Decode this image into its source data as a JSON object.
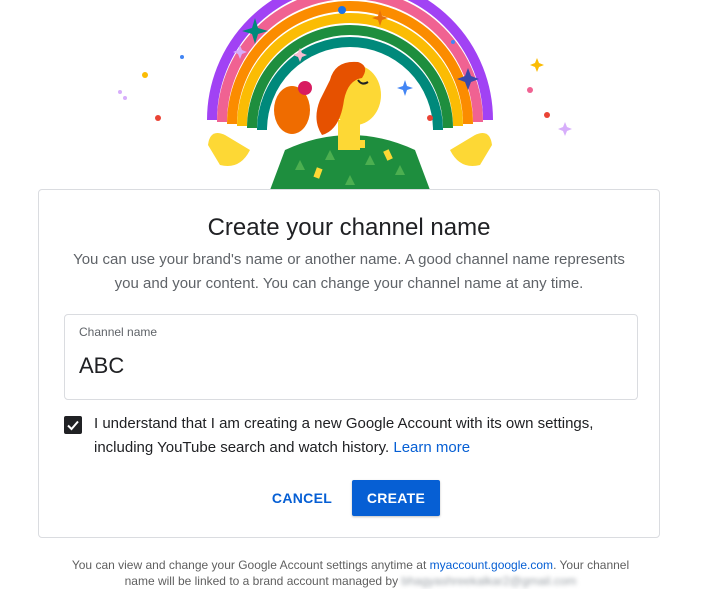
{
  "dialog": {
    "title": "Create your channel name",
    "subtitle": "You can use your brand's name or another name. A good channel name represents you and your content. You can change your channel name at any time.",
    "field_label": "Channel name",
    "field_value": "ABC",
    "checkbox_checked": true,
    "consent_text": "I understand that I am creating a new Google Account with its own settings, including YouTube search and watch history.",
    "learn_more": "Learn more",
    "cancel_label": "CANCEL",
    "create_label": "CREATE"
  },
  "footer": {
    "text_before": "You can view and change your Google Account settings anytime at",
    "link": "myaccount.google.com",
    "text_after": ". Your channel name will be linked to a brand account managed by",
    "email_redacted": "bhagyashreekalkar2@gmail.com"
  },
  "colors": {
    "accent": "#065fd4",
    "border": "#dadce0",
    "text": "#202124",
    "muted": "#5f6368"
  },
  "icons": {
    "checkbox": "checkmark-icon",
    "illustration": "rainbow-celebration-illustration"
  }
}
